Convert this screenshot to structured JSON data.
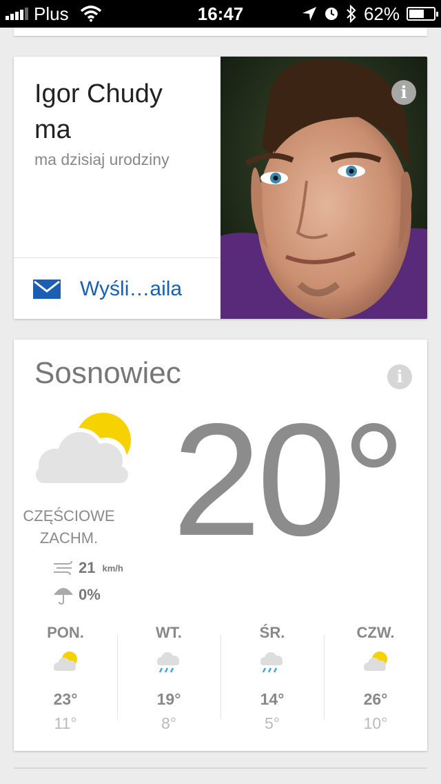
{
  "status_bar": {
    "carrier": "Plus",
    "time": "16:47",
    "battery": "62%",
    "battery_level": 0.62
  },
  "birthday_card": {
    "name_line1": "Igor Chudy",
    "name_line2": "ma",
    "subtitle": "ma dzisiaj urodziny",
    "action_label": "Wyśli…aila",
    "info_icon": "i",
    "photo_icon": "person-photo"
  },
  "weather_card": {
    "city": "Sosnowiec",
    "info_icon": "i",
    "temperature": "20°",
    "condition_line1": "CZĘŚCIOWE",
    "condition_line2": "ZACHM.",
    "wind_value": "21",
    "wind_unit": "km/h",
    "precip": "0%",
    "forecast": [
      {
        "day": "PON.",
        "icon": "partly-cloudy",
        "high": "23°",
        "low": "11°"
      },
      {
        "day": "WT.",
        "icon": "rain",
        "high": "19°",
        "low": "8°"
      },
      {
        "day": "ŚR.",
        "icon": "rain",
        "high": "14°",
        "low": "5°"
      },
      {
        "day": "CZW.",
        "icon": "partly-cloudy",
        "high": "26°",
        "low": "10°"
      }
    ]
  },
  "colors": {
    "accent_blue": "#1a5fb4",
    "sun_yellow": "#f5d200",
    "rain_blue": "#3aa6d9"
  }
}
